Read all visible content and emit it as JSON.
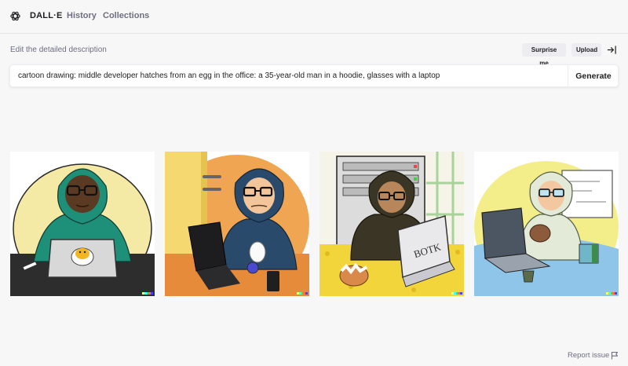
{
  "header": {
    "brand": "DALL·E",
    "nav": [
      "History",
      "Collections"
    ]
  },
  "editor": {
    "label": "Edit the detailed description",
    "surprise_label": "Surprise me",
    "upload_label": "Upload",
    "prompt_value": "cartoon drawing: middle developer hatches from an egg in the office: a 35-year-old man in a hoodie, glasses with a laptop",
    "generate_label": "Generate"
  },
  "results": {
    "images": [
      {
        "name": "generated-image-1",
        "laptop_text": ""
      },
      {
        "name": "generated-image-2",
        "laptop_text": ""
      },
      {
        "name": "generated-image-3",
        "laptop_text": "BOTK"
      },
      {
        "name": "generated-image-4",
        "laptop_text": ""
      }
    ],
    "signature_colors": [
      "#ffff66",
      "#42ffff",
      "#51da4c",
      "#ff6e3c",
      "#3c46ff"
    ]
  },
  "footer": {
    "report_label": "Report issue"
  },
  "icons": {
    "logo": "openai-logo-icon",
    "collapse": "collapse-sidebar-icon",
    "flag": "flag-icon"
  }
}
